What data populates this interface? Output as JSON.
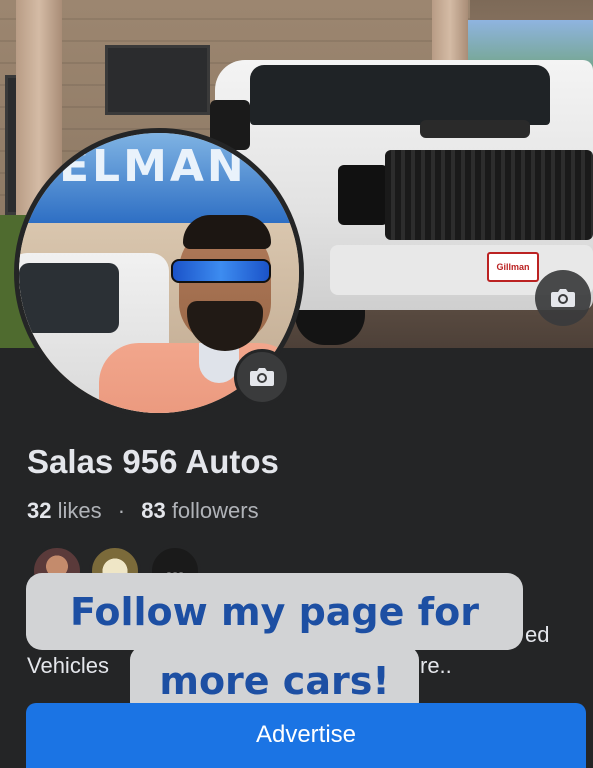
{
  "cover": {
    "plate_text": "Gillman"
  },
  "profile_picture": {
    "sign_text": "ELMAN"
  },
  "page": {
    "name": "Salas 956 Autos",
    "likes_count": "32",
    "likes_label": "likes",
    "separator": "·",
    "followers_count": "83",
    "followers_label": "followers"
  },
  "mutual_avatars": {
    "more_label": "..."
  },
  "description": {
    "line1_left": "Vehicles",
    "line1_right": "re..",
    "line0_right": "ed"
  },
  "sticker": {
    "line1": "Follow my page for",
    "line2": "more cars!"
  },
  "actions": {
    "advertise_label": "Advertise"
  },
  "colors": {
    "background": "#242526",
    "primary_button": "#1b74e4",
    "sticker_bg": "#d2d3d5",
    "sticker_text": "#1d4fa3"
  },
  "icons": {
    "cover_camera": "camera-icon",
    "profile_camera": "camera-icon"
  }
}
